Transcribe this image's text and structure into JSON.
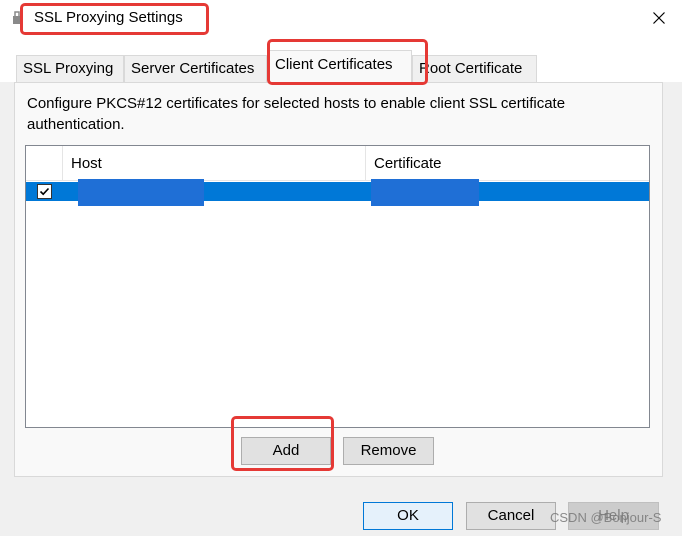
{
  "window": {
    "title": "SSL Proxying Settings",
    "close_icon": "close-icon"
  },
  "tabs": [
    {
      "label": "SSL Proxying",
      "active": false
    },
    {
      "label": "Server Certificates",
      "active": false
    },
    {
      "label": "Client Certificates",
      "active": true
    },
    {
      "label": "Root Certificate",
      "active": false
    }
  ],
  "panel": {
    "description": "Configure PKCS#12 certificates for selected hosts to enable client SSL certificate authentication."
  },
  "table": {
    "columns": [
      "",
      "Host",
      "Certificate"
    ],
    "rows": [
      {
        "checked": true,
        "host": "",
        "certificate": "",
        "selected": true
      }
    ]
  },
  "buttons": {
    "add": "Add",
    "remove": "Remove",
    "ok": "OK",
    "cancel": "Cancel",
    "help": "Help"
  },
  "watermark": "CSDN @Bonjour-S",
  "colors": {
    "selection": "#0078d7",
    "highlight_box": "#e53935"
  }
}
